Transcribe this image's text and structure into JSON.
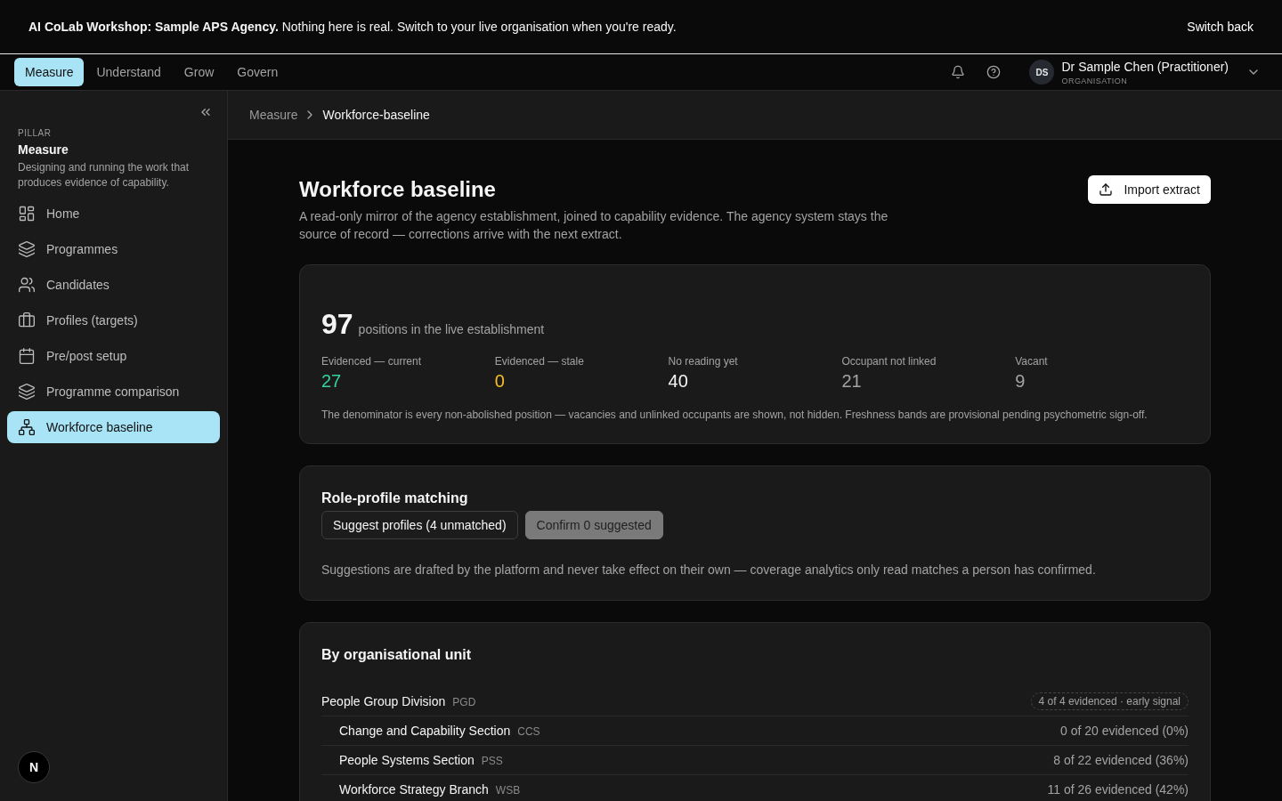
{
  "banner": {
    "lead": "AI CoLab Workshop: Sample APS Agency.",
    "message": "Nothing here is real. Switch to your live organisation when you're ready.",
    "action": "Switch back"
  },
  "nav": {
    "tabs": [
      {
        "label": "Measure",
        "selected": true
      },
      {
        "label": "Understand",
        "selected": false
      },
      {
        "label": "Grow",
        "selected": false
      },
      {
        "label": "Govern",
        "selected": false
      }
    ]
  },
  "user": {
    "initials": "DS",
    "name": "Dr Sample Chen (Practitioner)",
    "role": "ORGANISATION"
  },
  "sidebar": {
    "eyebrow": "PILLAR",
    "title": "Measure",
    "description": "Designing and running the work that produces evidence of capability.",
    "items": [
      {
        "label": "Home",
        "selected": false
      },
      {
        "label": "Programmes",
        "selected": false
      },
      {
        "label": "Candidates",
        "selected": false
      },
      {
        "label": "Profiles (targets)",
        "selected": false
      },
      {
        "label": "Pre/post setup",
        "selected": false
      },
      {
        "label": "Programme comparison",
        "selected": false
      },
      {
        "label": "Workforce baseline",
        "selected": true
      }
    ],
    "dev_badge": "N"
  },
  "breadcrumb": [
    {
      "label": "Measure",
      "current": false
    },
    {
      "label": "Workforce-baseline",
      "current": true
    }
  ],
  "page": {
    "title": "Workforce baseline",
    "description": "A read-only mirror of the agency establishment, joined to capability evidence. The agency system stays the source of record — corrections arrive with the next extract.",
    "import_button": "Import extract"
  },
  "summary": {
    "total": "97",
    "total_label": "positions in the live establishment",
    "stats": [
      {
        "label": "Evidenced — current",
        "value": "27",
        "color": "#34d399"
      },
      {
        "label": "Evidenced — stale",
        "value": "0",
        "color": "#fbbf24"
      },
      {
        "label": "No reading yet",
        "value": "40",
        "color": "#f5f5f5"
      },
      {
        "label": "Occupant not linked",
        "value": "21",
        "color": "#a3a3a3"
      },
      {
        "label": "Vacant",
        "value": "9",
        "color": "#a3a3a3"
      }
    ],
    "note": "The denominator is every non-abolished position — vacancies and unlinked occupants are shown, not hidden. Freshness bands are provisional pending psychometric sign-off."
  },
  "matching": {
    "title": "Role-profile matching",
    "buttons": [
      {
        "label": "Suggest profiles (4 unmatched)",
        "disabled": false
      },
      {
        "label": "Confirm 0 suggested",
        "disabled": true
      }
    ],
    "note": "Suggestions are drafted by the platform and never take effect on their own — coverage analytics only read matches a person has confirmed."
  },
  "units": {
    "title": "By organisational unit",
    "rows": [
      {
        "name": "People Group Division",
        "code": "PGD",
        "summary": "4 of 4 evidenced · early signal",
        "kind": "badge",
        "children": [
          {
            "name": "Change and Capability Section",
            "code": "CCS",
            "summary": "0 of 20 evidenced (0%)",
            "kind": "text"
          },
          {
            "name": "People Systems Section",
            "code": "PSS",
            "summary": "8 of 22 evidenced (36%)",
            "kind": "text"
          },
          {
            "name": "Workforce Strategy Branch",
            "code": "WSB",
            "summary": "11 of 26 evidenced (42%)",
            "kind": "text"
          }
        ]
      }
    ]
  }
}
